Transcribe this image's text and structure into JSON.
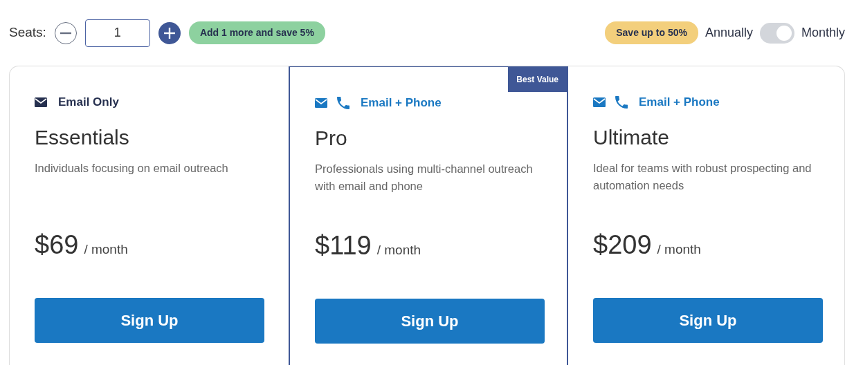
{
  "seats": {
    "label": "Seats:",
    "value": "1",
    "promo": "Add 1 more and save 5%"
  },
  "billing": {
    "promo": "Save up to 50%",
    "left_label": "Annually",
    "right_label": "Monthly",
    "on": true
  },
  "plans": [
    {
      "channel_icons": [
        {
          "kind": "email"
        }
      ],
      "channel_highlighted": false,
      "channel": "Email Only",
      "name": "Essentials",
      "description": "Individuals focusing on email outreach",
      "price": "$69",
      "period": "/ month",
      "button": "Sign Up",
      "featured": false
    },
    {
      "channel_icons": [
        {
          "kind": "email"
        },
        {
          "kind": "phone"
        }
      ],
      "channel_highlighted": true,
      "channel": "Email + Phone",
      "name": "Pro",
      "description": "Professionals using multi-channel outreach with email and phone",
      "price": "$119",
      "period": "/ month",
      "button": "Sign Up",
      "featured": true,
      "badge": "Best Value"
    },
    {
      "channel_icons": [
        {
          "kind": "email"
        },
        {
          "kind": "phone"
        }
      ],
      "channel_highlighted": true,
      "channel": "Email + Phone",
      "name": "Ultimate",
      "description": "Ideal for teams with robust prospecting and automation needs",
      "price": "$209",
      "period": "/ month",
      "button": "Sign Up",
      "featured": false
    }
  ]
}
